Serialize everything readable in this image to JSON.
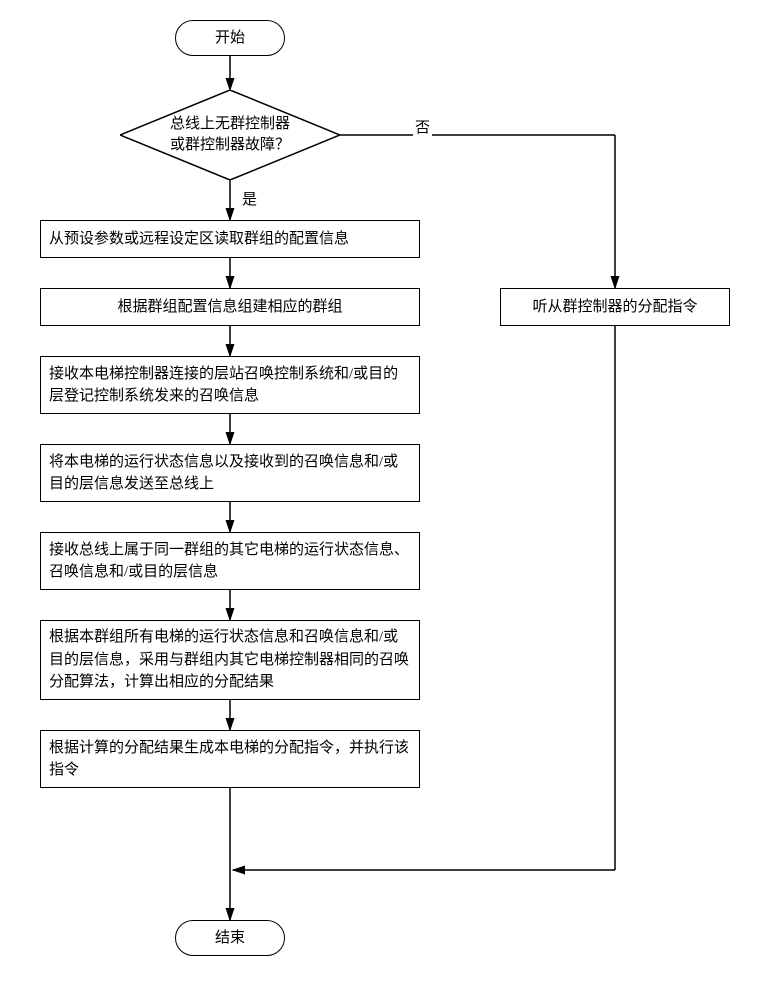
{
  "flow": {
    "start": "开始",
    "end": "结束",
    "decision": "总线上无群控制器\n或群控制器故障？",
    "yes": "是",
    "no": "否",
    "right_branch": "听从群控制器的分配指令",
    "steps": {
      "s1": "从预设参数或远程设定区读取群组的配置信息",
      "s2": "根据群组配置信息组建相应的群组",
      "s3": "接收本电梯控制器连接的层站召唤控制系统和/或目的层登记控制系统发来的召唤信息",
      "s4": "将本电梯的运行状态信息以及接收到的召唤信息和/或目的层信息发送至总线上",
      "s5": "接收总线上属于同一群组的其它电梯的运行状态信息、召唤信息和/或目的层信息",
      "s6": "根据本群组所有电梯的运行状态信息和召唤信息和/或目的层信息，采用与群组内其它电梯控制器相同的召唤分配算法，计算出相应的分配结果",
      "s7": "根据计算的分配结果生成本电梯的分配指令，并执行该指令"
    }
  }
}
